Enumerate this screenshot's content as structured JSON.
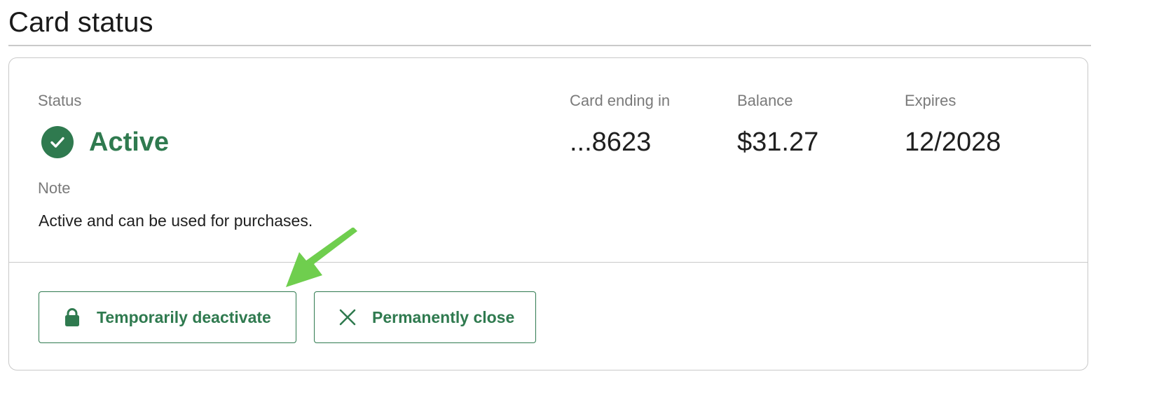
{
  "page": {
    "title": "Card status"
  },
  "card_status": {
    "status_label": "Status",
    "status_value": "Active",
    "status_icon": "check-circle-icon",
    "note_label": "Note",
    "note_text": "Active and can be used for purchases.",
    "card_ending_label": "Card ending in",
    "card_ending_value": "...8623",
    "balance_label": "Balance",
    "balance_value": "$31.27",
    "expires_label": "Expires",
    "expires_value": "12/2028"
  },
  "actions": {
    "deactivate_label": "Temporarily deactivate",
    "deactivate_icon": "lock-icon",
    "close_label": "Permanently close",
    "close_icon": "close-icon"
  },
  "annotation": {
    "arrow_icon": "pointer-arrow-icon"
  },
  "colors": {
    "accent_green": "#2f7a4f",
    "arrow_green": "#6fce4e",
    "muted_text": "#7a7a7a",
    "border": "#c9c9c9"
  }
}
